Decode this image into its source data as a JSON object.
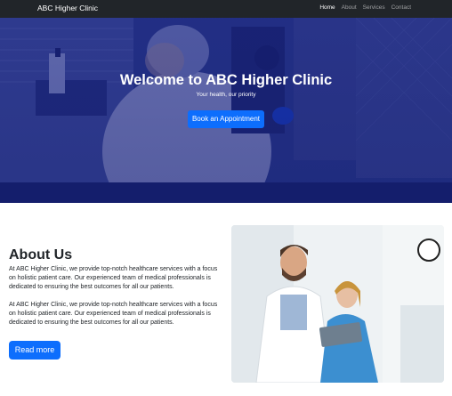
{
  "navbar": {
    "brand": "ABC Higher Clinic",
    "links": [
      {
        "label": "Home",
        "active": true
      },
      {
        "label": "About",
        "active": false
      },
      {
        "label": "Services",
        "active": false
      },
      {
        "label": "Contact",
        "active": false
      }
    ]
  },
  "hero": {
    "title": "Welcome to ABC Higher Clinic",
    "subtitle": "Your health, our priority",
    "cta_label": "Book an Appointment"
  },
  "about": {
    "title": "About Us",
    "paragraphs": [
      "At ABC Higher Clinic, we provide top-notch healthcare services with a focus on holistic patient care. Our experienced team of medical professionals is dedicated to ensuring the best outcomes for all our patients.",
      "At ABC Higher Clinic, we provide top-notch healthcare services with a focus on holistic patient care. Our experienced team of medical professionals is dedicated to ensuring the best outcomes for all our patients."
    ],
    "button_label": "Read more"
  },
  "colors": {
    "navbar_bg": "#212529",
    "primary": "#0d6efd",
    "hero_overlay": "#1a2a8c"
  }
}
